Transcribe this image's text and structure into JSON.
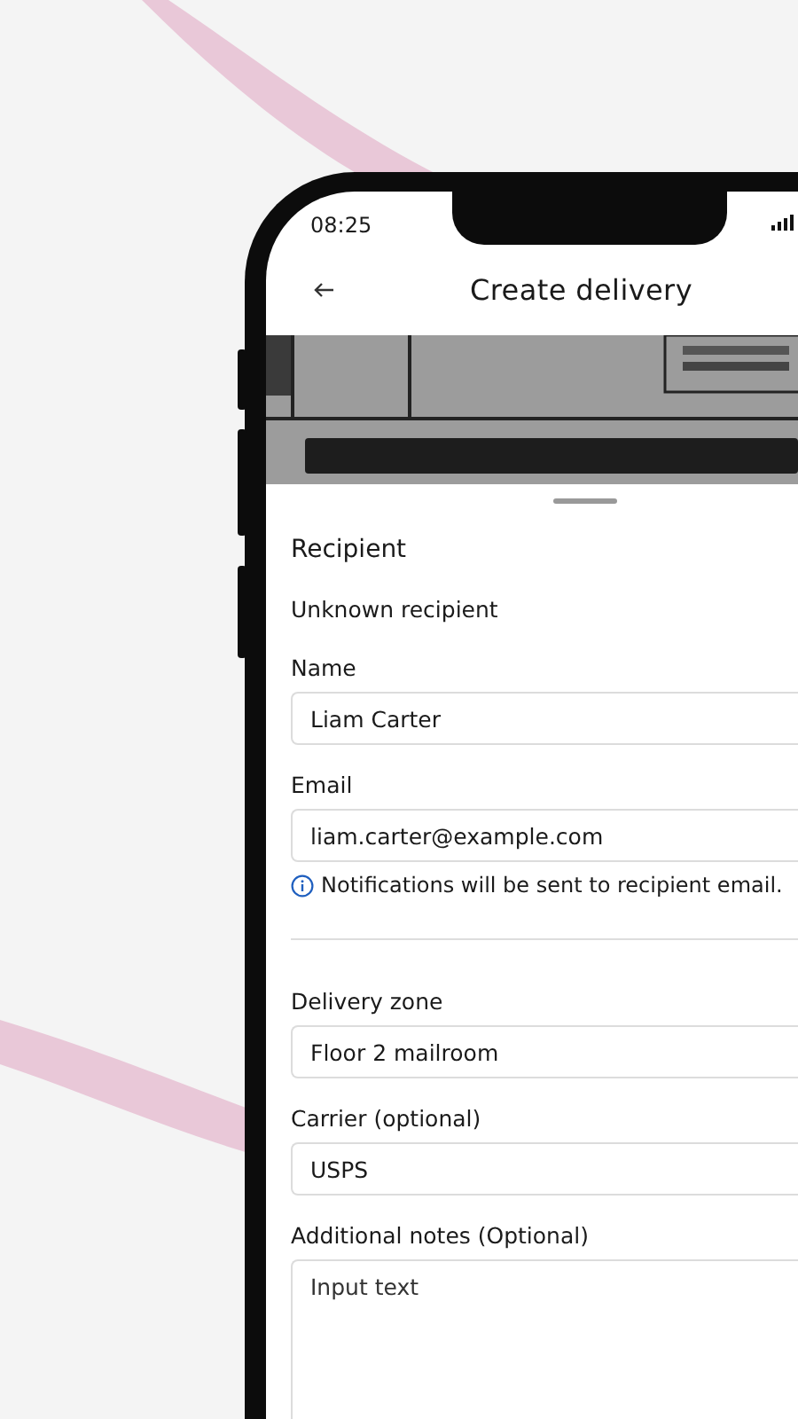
{
  "status_bar": {
    "time": "08:25"
  },
  "header": {
    "title": "Create delivery"
  },
  "sheet": {
    "title": "Recipient",
    "subtitle": "Unknown recipient",
    "sections": [
      {
        "fields": [
          {
            "label": "Name",
            "value": "Liam Carter"
          },
          {
            "label": "Email",
            "value": "liam.carter@example.com",
            "hint": "Notifications will be sent to recipient email."
          }
        ]
      },
      {
        "fields": [
          {
            "label": "Delivery zone",
            "value": "Floor 2 mailroom"
          },
          {
            "label": "Carrier (optional)",
            "value": "USPS"
          },
          {
            "label": "Additional notes (Optional)",
            "placeholder": "Input text",
            "kind": "multiline"
          }
        ]
      }
    ]
  }
}
